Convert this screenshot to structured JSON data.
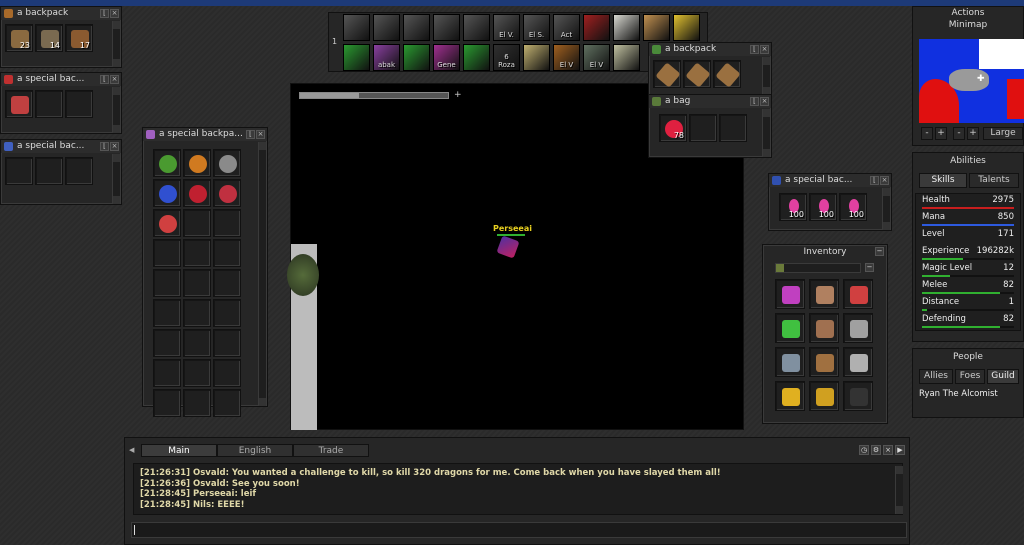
{
  "colors": {
    "health": "#c81e1e",
    "mana": "#2d5adf",
    "green": "#30b030",
    "chat_text": "#e0d8a8",
    "name_tag": "#e8d020"
  },
  "top_left": {
    "backpack1": {
      "title": "a backpack",
      "counts": [
        "23",
        "14",
        "17"
      ]
    },
    "special1": {
      "title": "a special bac..."
    },
    "special2": {
      "title": "a special bac..."
    }
  },
  "special_big": {
    "title": "a special backpa..."
  },
  "hotkeys": {
    "row1_num": "1",
    "row1": [
      "",
      "",
      "",
      "",
      "",
      "El V.",
      "El S.",
      "Act",
      "",
      "",
      "",
      ""
    ],
    "row2": [
      "",
      "abak",
      "",
      "Gene",
      "",
      "6\nRoza",
      "",
      "El V",
      "El V",
      "",
      "",
      ""
    ]
  },
  "floating": {
    "backpack": {
      "title": "a backpack"
    },
    "bag": {
      "title": "a bag",
      "count": "78"
    },
    "special": {
      "title": "a special bac...",
      "counts": [
        "100",
        "100",
        "100"
      ]
    }
  },
  "inventory": {
    "title": "Inventory"
  },
  "game": {
    "player": "Perseeai"
  },
  "right": {
    "actions": "Actions",
    "minimap": "Minimap",
    "zoom_label": "Large",
    "abilities": "Abilities",
    "tab_skills": "Skills",
    "tab_talents": "Talents",
    "skills": [
      {
        "name": "Health",
        "value": "2975",
        "color": "#c81e1e",
        "pct": 1.0
      },
      {
        "name": "Mana",
        "value": "850",
        "color": "#2d5adf",
        "pct": 1.0
      },
      {
        "name": "Level",
        "value": "171",
        "color": "",
        "pct": 0
      },
      {
        "name": "Experience",
        "value": "196282k",
        "color": "#30b030",
        "pct": 0.45
      },
      {
        "name": "Magic Level",
        "value": "12",
        "color": "#30b030",
        "pct": 0.3
      },
      {
        "name": "Melee",
        "value": "82",
        "color": "#30b030",
        "pct": 0.85
      },
      {
        "name": "Distance",
        "value": "1",
        "color": "#30b030",
        "pct": 0.05
      },
      {
        "name": "Defending",
        "value": "82",
        "color": "#30b030",
        "pct": 0.85
      }
    ],
    "people": "People",
    "tab_allies": "Allies",
    "tab_foes": "Foes",
    "tab_guild": "Guild",
    "people_list": [
      "Ryan The Alcomist"
    ]
  },
  "chat": {
    "tabs": [
      "Main",
      "English",
      "Trade"
    ],
    "lines": [
      "[21:26:31] Osvald: You wanted a challenge to kill, so kill 320 dragons for me. Come back when you have slayed them all!",
      "[21:26:36] Osvald: See you soon!",
      "[21:28:45] Perseeai: leif",
      "[21:28:45] Nils: EEEE!"
    ]
  }
}
